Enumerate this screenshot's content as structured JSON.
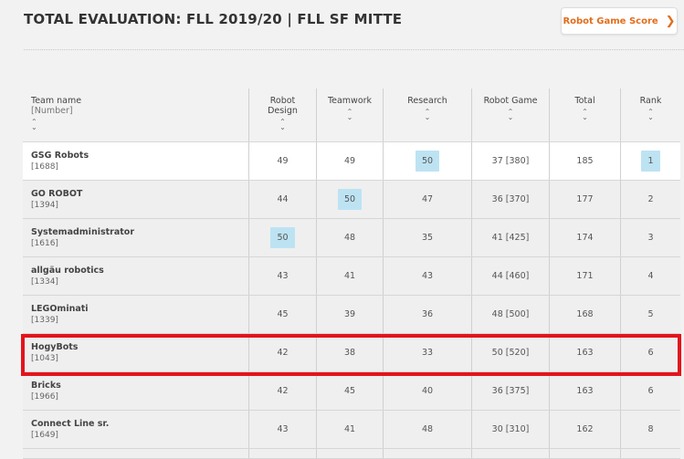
{
  "page": {
    "title": "TOTAL EVALUATION: FLL 2019/20 | FLL SF MITTE",
    "score_button": "Robot Game Score",
    "score_button_icon": "chevron-right-icon"
  },
  "headers": {
    "name": "Team name",
    "name_sub": "[Number]",
    "robot_design_1": "Robot",
    "robot_design_2": "Design",
    "teamwork": "Teamwork",
    "research": "Research",
    "robot_game": "Robot Game",
    "total": "Total",
    "rank": "Rank"
  },
  "rows": [
    {
      "name": "GSG Robots",
      "number": "[1688]",
      "robot_design": "49",
      "teamwork": "49",
      "research": "50",
      "robot_game": "37 [380]",
      "total": "185",
      "rank": "1"
    },
    {
      "name": "GO ROBOT",
      "number": "[1394]",
      "robot_design": "44",
      "teamwork": "50",
      "research": "47",
      "robot_game": "36 [370]",
      "total": "177",
      "rank": "2"
    },
    {
      "name": "Systemadministrator",
      "number": "[1616]",
      "robot_design": "50",
      "teamwork": "48",
      "research": "35",
      "robot_game": "41 [425]",
      "total": "174",
      "rank": "3"
    },
    {
      "name": "allgäu robotics",
      "number": "[1334]",
      "robot_design": "43",
      "teamwork": "41",
      "research": "43",
      "robot_game": "44 [460]",
      "total": "171",
      "rank": "4"
    },
    {
      "name": "LEGOminati",
      "number": "[1339]",
      "robot_design": "45",
      "teamwork": "39",
      "research": "36",
      "robot_game": "48 [500]",
      "total": "168",
      "rank": "5"
    },
    {
      "name": "HogyBots",
      "number": "[1043]",
      "robot_design": "42",
      "teamwork": "38",
      "research": "33",
      "robot_game": "50 [520]",
      "total": "163",
      "rank": "6"
    },
    {
      "name": "Bricks",
      "number": "[1966]",
      "robot_design": "42",
      "teamwork": "45",
      "research": "40",
      "robot_game": "36 [375]",
      "total": "163",
      "rank": "6"
    },
    {
      "name": "Connect Line sr.",
      "number": "[1649]",
      "robot_design": "43",
      "teamwork": "41",
      "research": "48",
      "robot_game": "30 [310]",
      "total": "162",
      "rank": "8"
    }
  ],
  "colors": {
    "accent": "#e26d1b",
    "highlight": "#bde3f3",
    "selection_box": "#e3141c"
  }
}
